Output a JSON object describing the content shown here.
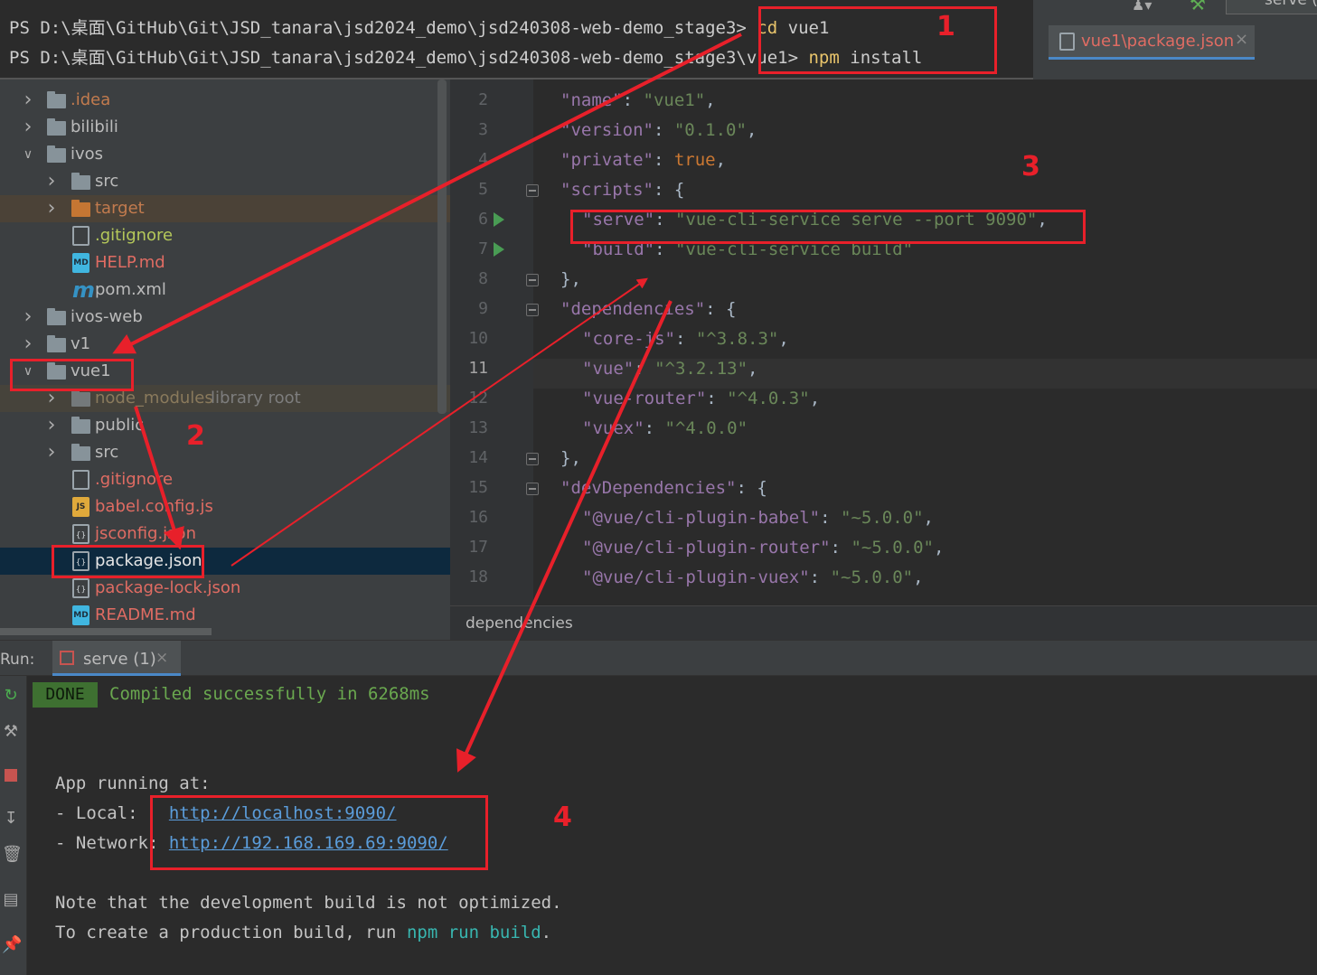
{
  "terminal": {
    "line1_prompt": "PS D:\\桌面\\GitHub\\Git\\JSD_tanara\\jsd2024_demo\\jsd240308-web-demo_stage3> ",
    "line1_cmd": "cd",
    "line1_arg": " vue1",
    "line2_prompt": "PS D:\\桌面\\GitHub\\Git\\JSD_tanara\\jsd2024_demo\\jsd240308-web-demo_stage3\\vue1> ",
    "line2_cmd": "npm",
    "line2_arg": " install"
  },
  "toolbar": {
    "serve_label": "serve (",
    "user_icon": "user-dropdown-icon",
    "hammer_icon": "build-hammer-icon"
  },
  "editor_tab": {
    "label": "vue1\\package.json",
    "close": "×"
  },
  "project_tree": [
    {
      "label": ".idea",
      "kind": "folder",
      "expanded": false
    },
    {
      "label": "bilibili",
      "kind": "folder",
      "expanded": false
    },
    {
      "label": "ivos",
      "kind": "folder",
      "expanded": true
    },
    {
      "label": "src",
      "kind": "folder",
      "expanded": false
    },
    {
      "label": "target",
      "kind": "folder",
      "expanded": false
    },
    {
      "label": ".gitignore",
      "kind": "file"
    },
    {
      "label": "HELP.md",
      "kind": "md"
    },
    {
      "label": "pom.xml",
      "kind": "maven"
    },
    {
      "label": "ivos-web",
      "kind": "folder",
      "expanded": false
    },
    {
      "label": "v1",
      "kind": "folder",
      "expanded": false
    },
    {
      "label": "vue1",
      "kind": "folder",
      "expanded": true
    },
    {
      "label": "node_modules",
      "suffix": "library root",
      "kind": "folder",
      "expanded": false
    },
    {
      "label": "public",
      "kind": "folder",
      "expanded": false
    },
    {
      "label": "src",
      "kind": "folder",
      "expanded": false
    },
    {
      "label": ".gitignore",
      "kind": "file"
    },
    {
      "label": "babel.config.js",
      "kind": "js"
    },
    {
      "label": "jsconfig.json",
      "kind": "json"
    },
    {
      "label": "package.json",
      "kind": "json",
      "selected": true
    },
    {
      "label": "package-lock.json",
      "kind": "json"
    },
    {
      "label": "README.md",
      "kind": "md"
    }
  ],
  "editor": {
    "line_numbers": [
      "2",
      "3",
      "4",
      "5",
      "6",
      "7",
      "8",
      "9",
      "10",
      "11",
      "12",
      "13",
      "14",
      "15",
      "16",
      "17",
      "18"
    ],
    "current_line": "11",
    "lines": [
      {
        "key": "\"name\"",
        "sep": ": ",
        "val": "\"vue1\"",
        "end": ","
      },
      {
        "key": "\"version\"",
        "sep": ": ",
        "val": "\"0.1.0\"",
        "end": ","
      },
      {
        "key": "\"private\"",
        "sep": ": ",
        "val": "true",
        "end": ","
      },
      {
        "key": "\"scripts\"",
        "sep": ": ",
        "val": "{",
        "end": ""
      },
      {
        "key": "\"serve\"",
        "sep": ": ",
        "val": "\"vue-cli-service serve --port 9090\"",
        "end": ","
      },
      {
        "key": "\"build\"",
        "sep": ": ",
        "val": "\"vue-cli-service build\"",
        "end": ""
      },
      {
        "key": "",
        "sep": "",
        "val": "},",
        "end": ""
      },
      {
        "key": "\"dependencies\"",
        "sep": ": ",
        "val": "{",
        "end": ""
      },
      {
        "key": "\"core-js\"",
        "sep": ": ",
        "val": "\"^3.8.3\"",
        "end": ","
      },
      {
        "key": "\"vue\"",
        "sep": ": ",
        "val": "\"^3.2.13\"",
        "end": ","
      },
      {
        "key": "\"vue-router\"",
        "sep": ": ",
        "val": "\"^4.0.3\"",
        "end": ","
      },
      {
        "key": "\"vuex\"",
        "sep": ": ",
        "val": "\"^4.0.0\"",
        "end": ""
      },
      {
        "key": "",
        "sep": "",
        "val": "},",
        "end": ""
      },
      {
        "key": "\"devDependencies\"",
        "sep": ": ",
        "val": "{",
        "end": ""
      },
      {
        "key": "\"@vue/cli-plugin-babel\"",
        "sep": ": ",
        "val": "\"~5.0.0\"",
        "end": ","
      },
      {
        "key": "\"@vue/cli-plugin-router\"",
        "sep": ": ",
        "val": "\"~5.0.0\"",
        "end": ","
      },
      {
        "key": "\"@vue/cli-plugin-vuex\"",
        "sep": ": ",
        "val": "\"~5.0.0\"",
        "end": ","
      }
    ],
    "breadcrumb": "dependencies"
  },
  "run_panel": {
    "label": "Run:",
    "tab_label": "serve (1)",
    "tab_close": "×",
    "done_badge": "DONE",
    "compiled_msg": "Compiled successfully in 6268ms",
    "app_running": "App running at:",
    "local_label": "- Local:   ",
    "local_url": "http://localhost:9090/",
    "network_label": "- Network: ",
    "network_url": "http://192.168.169.69:9090/",
    "note_line": "Note that the development build is not optimized.",
    "create_prefix": "To create a production build, run ",
    "create_cmd": "npm run build",
    "create_suffix": "."
  },
  "annotations": {
    "n1": "1",
    "n2": "2",
    "n3": "3",
    "n4": "4",
    "color": "#e8202a"
  }
}
